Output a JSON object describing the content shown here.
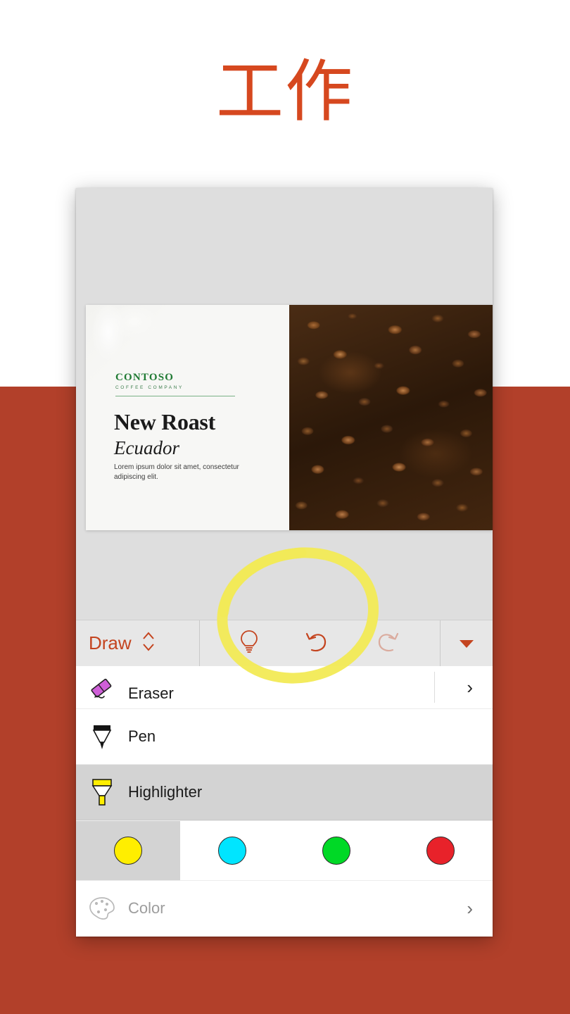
{
  "page": {
    "heading": "工作",
    "heading_color": "#d6481f",
    "background_top_color": "#ffffff",
    "background_bottom_color": "#b2402a"
  },
  "slide": {
    "logo_name": "CONTOSO",
    "logo_sub": "COFFEE COMPANY",
    "logo_color": "#1f7a33",
    "title": "New Roast",
    "subtitle": "Ecuador",
    "body": "Lorem ipsum dolor sit amet, consectetur adipiscing elit.",
    "photo_alt": "coffee-beans",
    "ink_color": "#f2ea55"
  },
  "ribbon": {
    "tab_label": "Draw",
    "tab_color": "#c4441f",
    "actions": [
      {
        "name": "tell-me-icon",
        "title": "Tell me",
        "enabled": true
      },
      {
        "name": "undo-icon",
        "title": "Undo",
        "enabled": true
      },
      {
        "name": "redo-icon",
        "title": "Redo",
        "enabled": false
      }
    ],
    "more_label": "▼"
  },
  "tools": [
    {
      "label": "Eraser",
      "icon": "eraser-icon",
      "selected": false,
      "chevron": "›"
    },
    {
      "label": "Pen",
      "icon": "pen-icon",
      "selected": false,
      "chevron": ""
    },
    {
      "label": "Highlighter",
      "icon": "highlighter-icon",
      "selected": true,
      "chevron": ""
    }
  ],
  "colors": [
    {
      "name": "yellow",
      "hex": "#ffee00",
      "selected": true
    },
    {
      "name": "cyan",
      "hex": "#00e5ff",
      "selected": false
    },
    {
      "name": "green",
      "hex": "#00d926",
      "selected": false
    },
    {
      "name": "red",
      "hex": "#e8222a",
      "selected": false
    }
  ],
  "color_row": {
    "label": "Color",
    "icon": "palette-icon",
    "chevron": "›"
  }
}
